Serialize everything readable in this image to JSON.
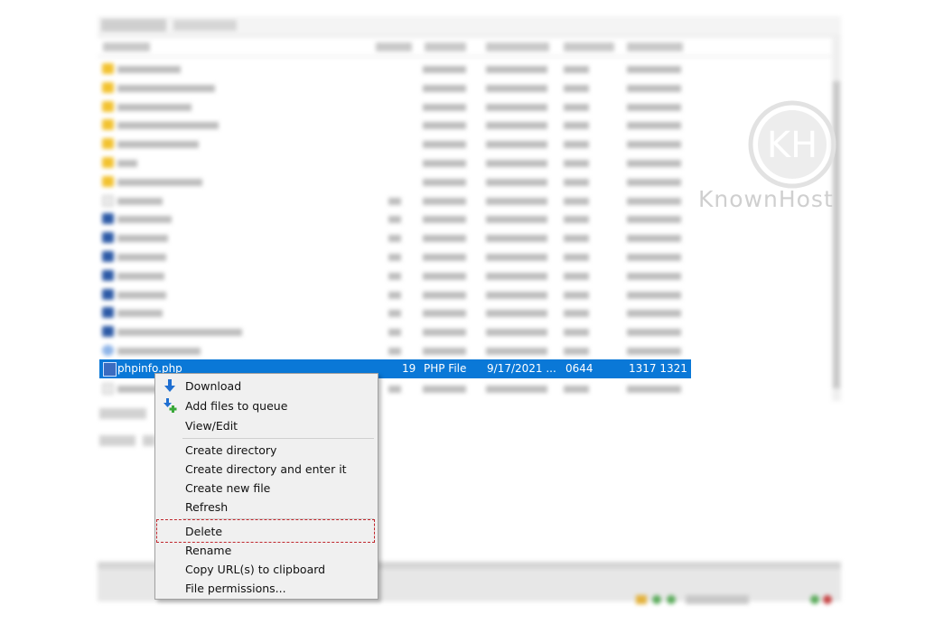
{
  "watermark": {
    "brand": "KnownHost",
    "monogram": "KH"
  },
  "selected_file": {
    "name": "phpinfo.php",
    "size": "19",
    "type": "PHP File",
    "modified": "9/17/2021 ...",
    "permissions": "0644",
    "owner_group": "1317 1321"
  },
  "context_menu": {
    "items": [
      {
        "label": "Download",
        "icon": "download-arrow-icon"
      },
      {
        "label": "Add files to queue",
        "icon": "add-to-queue-icon"
      },
      {
        "label": "View/Edit"
      },
      {
        "label": "Create directory"
      },
      {
        "label": "Create directory and enter it"
      },
      {
        "label": "Create new file"
      },
      {
        "label": "Refresh"
      },
      {
        "label": "Delete"
      },
      {
        "label": "Rename"
      },
      {
        "label": "Copy URL(s) to clipboard"
      },
      {
        "label": "File permissions..."
      }
    ]
  },
  "colors": {
    "selection": "#0a78d7",
    "highlight_border": "#c0262c",
    "menu_bg": "#f0f0f0"
  }
}
